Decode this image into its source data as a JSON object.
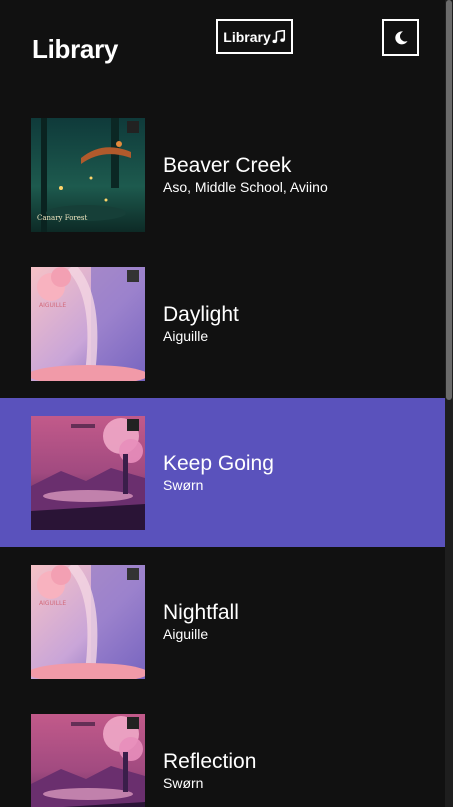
{
  "header": {
    "title": "Library",
    "library_button_label": "Library",
    "library_button_icon": "music-note-icon",
    "theme_button_icon": "moon-icon"
  },
  "songs": [
    {
      "title": "Beaver Creek",
      "artist": "Aso, Middle School, Aviino",
      "art": "forest-night-art",
      "art_text": "Canary Forest",
      "active": false
    },
    {
      "title": "Daylight",
      "artist": "Aiguille",
      "art": "pink-flowers-art",
      "art_text": "AIGUILLE",
      "active": false
    },
    {
      "title": "Keep Going",
      "artist": "Swørn",
      "art": "pink-landscape-art",
      "art_text": "",
      "active": true
    },
    {
      "title": "Nightfall",
      "artist": "Aiguille",
      "art": "pink-flowers-art",
      "art_text": "AIGUILLE",
      "active": false
    },
    {
      "title": "Reflection",
      "artist": "Swørn",
      "art": "pink-landscape-art",
      "art_text": "",
      "active": false
    }
  ],
  "colors": {
    "background": "#111111",
    "active_row": "#5a52bc",
    "text": "#ffffff"
  }
}
